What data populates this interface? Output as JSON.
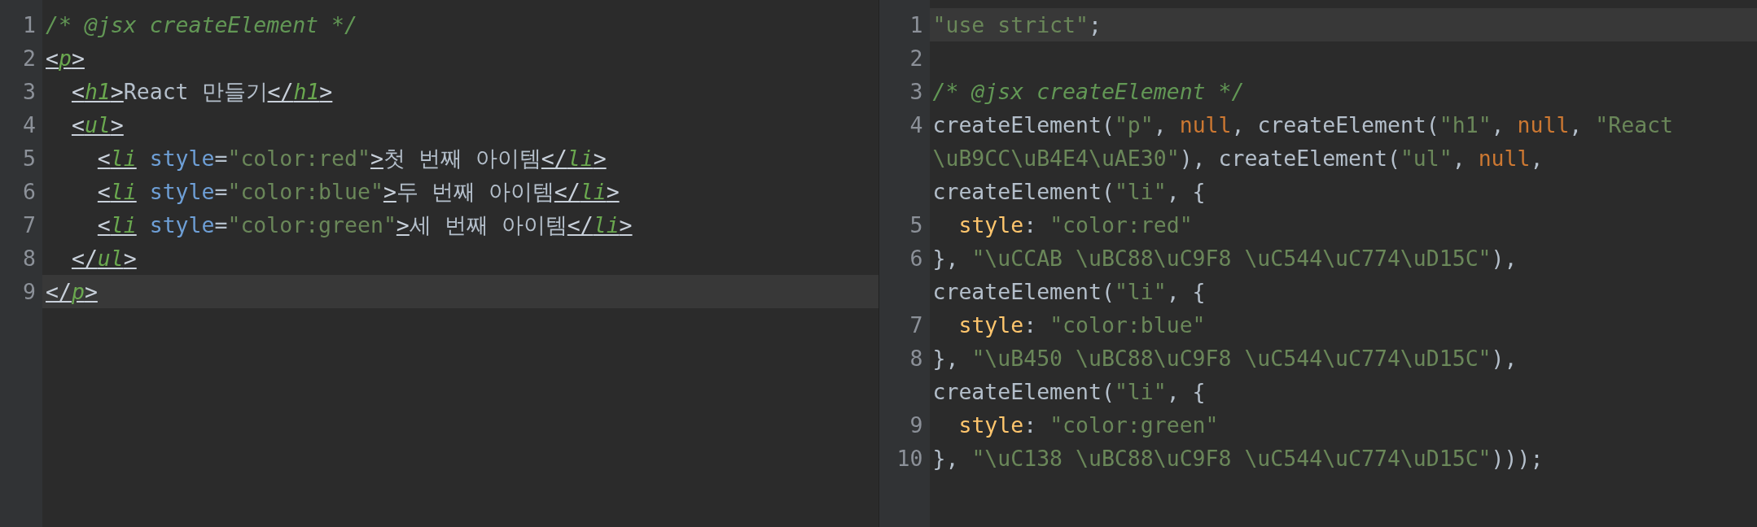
{
  "panes": [
    {
      "lines": [
        {
          "number": "1",
          "current": false,
          "tokens": [
            {
              "kind": "comment",
              "text": "/* @jsx createElement */"
            }
          ]
        },
        {
          "number": "2",
          "current": false,
          "tokens": [
            {
              "kind": "tag",
              "text": "<"
            },
            {
              "kind": "tagname",
              "text": "p"
            },
            {
              "kind": "tag",
              "text": ">"
            }
          ]
        },
        {
          "number": "3",
          "current": false,
          "tokens": [
            {
              "kind": "tag",
              "text": "  <"
            },
            {
              "kind": "tagname",
              "text": "h1"
            },
            {
              "kind": "tag",
              "text": ">"
            },
            {
              "kind": "text",
              "text": "React 만들기"
            },
            {
              "kind": "tag",
              "text": "</"
            },
            {
              "kind": "tagname",
              "text": "h1"
            },
            {
              "kind": "tag",
              "text": ">"
            }
          ]
        },
        {
          "number": "4",
          "current": false,
          "tokens": [
            {
              "kind": "tag",
              "text": "  <"
            },
            {
              "kind": "tagname",
              "text": "ul"
            },
            {
              "kind": "tag",
              "text": ">"
            }
          ]
        },
        {
          "number": "5",
          "current": false,
          "tokens": [
            {
              "kind": "tag",
              "text": "    <"
            },
            {
              "kind": "tagname",
              "text": "li"
            },
            {
              "kind": "attr",
              "text": " style"
            },
            {
              "kind": "text",
              "text": "="
            },
            {
              "kind": "string",
              "text": "\"color:red\""
            },
            {
              "kind": "tag",
              "text": ">"
            },
            {
              "kind": "text",
              "text": "첫 번째 아이템"
            },
            {
              "kind": "tag",
              "text": "</"
            },
            {
              "kind": "tagname",
              "text": "li"
            },
            {
              "kind": "tag",
              "text": ">"
            }
          ]
        },
        {
          "number": "6",
          "current": false,
          "tokens": [
            {
              "kind": "tag",
              "text": "    <"
            },
            {
              "kind": "tagname",
              "text": "li"
            },
            {
              "kind": "attr",
              "text": " style"
            },
            {
              "kind": "text",
              "text": "="
            },
            {
              "kind": "string",
              "text": "\"color:blue\""
            },
            {
              "kind": "tag",
              "text": ">"
            },
            {
              "kind": "text",
              "text": "두 번째 아이템"
            },
            {
              "kind": "tag",
              "text": "</"
            },
            {
              "kind": "tagname",
              "text": "li"
            },
            {
              "kind": "tag",
              "text": ">"
            }
          ]
        },
        {
          "number": "7",
          "current": false,
          "tokens": [
            {
              "kind": "tag",
              "text": "    <"
            },
            {
              "kind": "tagname",
              "text": "li"
            },
            {
              "kind": "attr",
              "text": " style"
            },
            {
              "kind": "text",
              "text": "="
            },
            {
              "kind": "string",
              "text": "\"color:green\""
            },
            {
              "kind": "tag",
              "text": ">"
            },
            {
              "kind": "text",
              "text": "세 번째 아이템"
            },
            {
              "kind": "tag",
              "text": "</"
            },
            {
              "kind": "tagname",
              "text": "li"
            },
            {
              "kind": "tag",
              "text": ">"
            }
          ]
        },
        {
          "number": "8",
          "current": false,
          "tokens": [
            {
              "kind": "tag",
              "text": "  </"
            },
            {
              "kind": "tagname",
              "text": "ul"
            },
            {
              "kind": "tag",
              "text": ">"
            }
          ]
        },
        {
          "number": "9",
          "current": true,
          "tokens": [
            {
              "kind": "tag",
              "text": "</"
            },
            {
              "kind": "tagname",
              "text": "p"
            },
            {
              "kind": "tag",
              "text": ">"
            }
          ]
        }
      ]
    },
    {
      "lines": [
        {
          "number": "1",
          "current": true,
          "tokens": [
            {
              "kind": "string",
              "text": "\"use strict\""
            },
            {
              "kind": "text",
              "text": ";"
            }
          ]
        },
        {
          "number": "2",
          "current": false
        },
        {
          "number": "3",
          "current": false,
          "tokens": [
            {
              "kind": "comment",
              "text": "/* @jsx createElement */"
            }
          ]
        },
        {
          "number": "4",
          "current": false,
          "tokens": [
            {
              "kind": "text",
              "text": "createElement("
            },
            {
              "kind": "string",
              "text": "\"p\""
            },
            {
              "kind": "text",
              "text": ", "
            },
            {
              "kind": "keyword",
              "text": "null"
            },
            {
              "kind": "text",
              "text": ", createElement("
            },
            {
              "kind": "string",
              "text": "\"h1\""
            },
            {
              "kind": "text",
              "text": ", "
            },
            {
              "kind": "keyword",
              "text": "null"
            },
            {
              "kind": "text",
              "text": ", "
            },
            {
              "kind": "string",
              "text": "\"React"
            }
          ]
        },
        {
          "current": false,
          "tokens": [
            {
              "kind": "string",
              "text": "\\uB9CC\\uB4E4\\uAE30\""
            },
            {
              "kind": "text",
              "text": "), createElement("
            },
            {
              "kind": "string",
              "text": "\"ul\""
            },
            {
              "kind": "text",
              "text": ", "
            },
            {
              "kind": "keyword",
              "text": "null"
            },
            {
              "kind": "text",
              "text": ","
            }
          ]
        },
        {
          "current": false,
          "tokens": [
            {
              "kind": "text",
              "text": "createElement("
            },
            {
              "kind": "string",
              "text": "\"li\""
            },
            {
              "kind": "text",
              "text": ", {"
            }
          ]
        },
        {
          "number": "5",
          "current": false,
          "tokens": [
            {
              "kind": "property",
              "text": "  style"
            },
            {
              "kind": "text",
              "text": ": "
            },
            {
              "kind": "string",
              "text": "\"color:red\""
            }
          ]
        },
        {
          "number": "6",
          "current": false,
          "tokens": [
            {
              "kind": "text",
              "text": "}, "
            },
            {
              "kind": "string",
              "text": "\"\\uCCAB \\uBC88\\uC9F8 \\uC544\\uC774\\uD15C\""
            },
            {
              "kind": "text",
              "text": "),"
            }
          ]
        },
        {
          "current": false,
          "tokens": [
            {
              "kind": "text",
              "text": "createElement("
            },
            {
              "kind": "string",
              "text": "\"li\""
            },
            {
              "kind": "text",
              "text": ", {"
            }
          ]
        },
        {
          "number": "7",
          "current": false,
          "tokens": [
            {
              "kind": "property",
              "text": "  style"
            },
            {
              "kind": "text",
              "text": ": "
            },
            {
              "kind": "string",
              "text": "\"color:blue\""
            }
          ]
        },
        {
          "number": "8",
          "current": false,
          "tokens": [
            {
              "kind": "text",
              "text": "}, "
            },
            {
              "kind": "string",
              "text": "\"\\uB450 \\uBC88\\uC9F8 \\uC544\\uC774\\uD15C\""
            },
            {
              "kind": "text",
              "text": "),"
            }
          ]
        },
        {
          "current": false,
          "tokens": [
            {
              "kind": "text",
              "text": "createElement("
            },
            {
              "kind": "string",
              "text": "\"li\""
            },
            {
              "kind": "text",
              "text": ", {"
            }
          ]
        },
        {
          "number": "9",
          "current": false,
          "tokens": [
            {
              "kind": "property",
              "text": "  style"
            },
            {
              "kind": "text",
              "text": ": "
            },
            {
              "kind": "string",
              "text": "\"color:green\""
            }
          ]
        },
        {
          "number": "10",
          "current": false,
          "tokens": [
            {
              "kind": "text",
              "text": "}, "
            },
            {
              "kind": "string",
              "text": "\"\\uC138 \\uBC88\\uC9F8 \\uC544\\uC774\\uD15C\""
            },
            {
              "kind": "text",
              "text": ")));"
            }
          ]
        }
      ]
    }
  ]
}
